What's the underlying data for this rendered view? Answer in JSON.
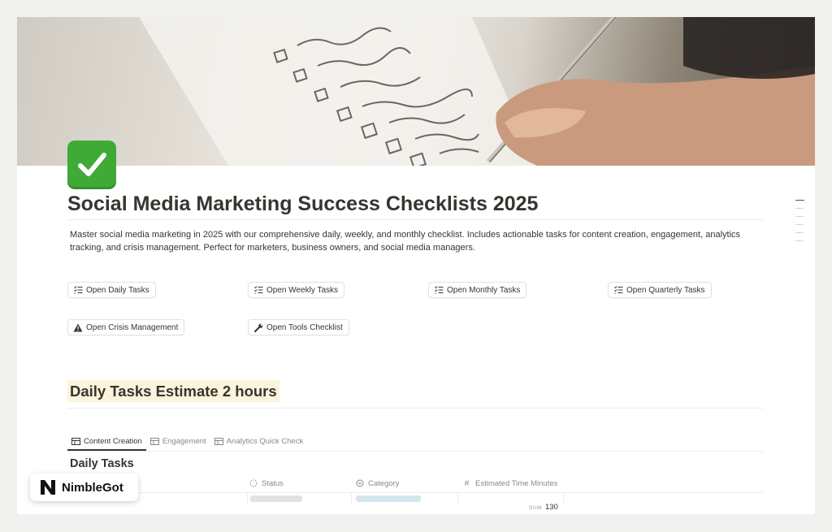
{
  "page": {
    "title": "Social Media Marketing Success Checklists 2025",
    "description": "Master social media marketing in 2025 with our comprehensive daily, weekly, and monthly checklist. Includes actionable tasks for content creation, engagement, analytics tracking, and crisis management. Perfect for marketers, business owners, and social media managers.",
    "icon": "check-mark-emoji"
  },
  "buttons": [
    {
      "label": "Open Daily Tasks",
      "icon": "checklist-icon"
    },
    {
      "label": "Open Weekly Tasks",
      "icon": "checklist-icon"
    },
    {
      "label": "Open Monthly Tasks",
      "icon": "checklist-icon"
    },
    {
      "label": "Open Quarterly Tasks",
      "icon": "checklist-icon"
    },
    {
      "label": "Open Crisis Management",
      "icon": "warning-icon"
    },
    {
      "label": "Open Tools Checklist",
      "icon": "wrench-icon"
    }
  ],
  "section": {
    "heading": "Daily Tasks Estimate 2 hours",
    "heading_bg": "#fbf3db"
  },
  "tabs": [
    {
      "label": "Content Creation",
      "active": true
    },
    {
      "label": "Engagement",
      "active": false
    },
    {
      "label": "Analytics Quick Check",
      "active": false
    }
  ],
  "database": {
    "title": "Daily Tasks",
    "columns": [
      {
        "label": "Status",
        "icon": "status-icon"
      },
      {
        "label": "Category",
        "icon": "select-icon"
      },
      {
        "label": "Estimated Time Minutes",
        "icon": "number-icon"
      }
    ],
    "sum_label": "SUM",
    "sum_value": "130"
  },
  "brand": {
    "name": "NimbleGot"
  },
  "colors": {
    "accent_green": "#3faa35",
    "text": "#37352f",
    "muted": "#8a8984"
  }
}
